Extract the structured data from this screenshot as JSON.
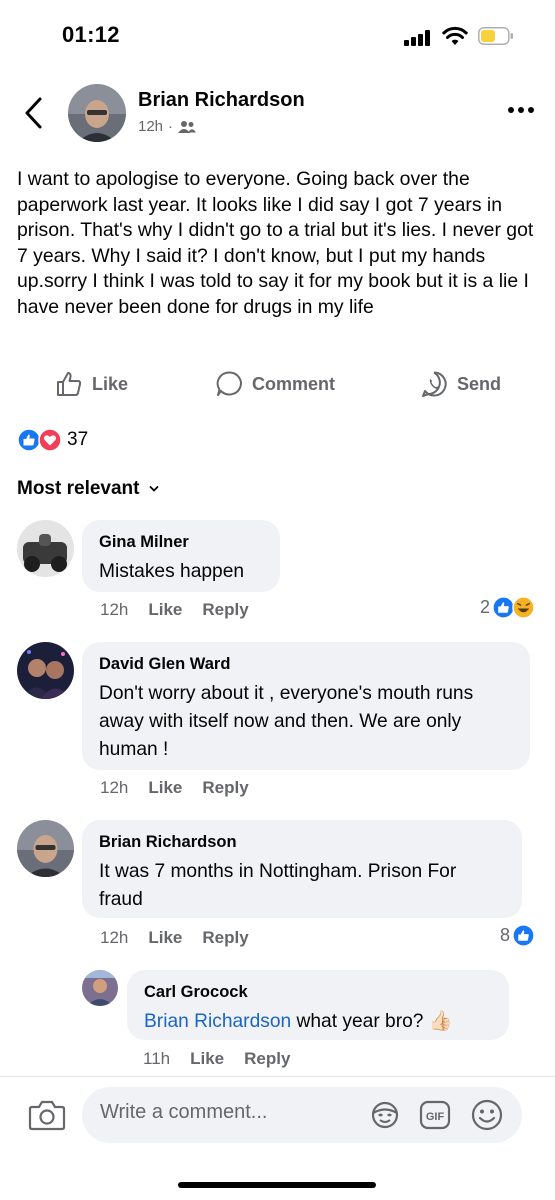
{
  "status": {
    "time": "01:12"
  },
  "post": {
    "author": "Brian Richardson",
    "time": "12h",
    "text": "I want to apologise to everyone. Going back over the paperwork last year. It looks like I did say I got 7 years in prison. That's why I didn't go to a trial but it's lies. I never got 7 years. Why I said it? I don't know, but I put my hands up.sorry I think I was told to say it for my book but it is a lie  I have never been done for drugs  in my life"
  },
  "actions": {
    "like": "Like",
    "comment": "Comment",
    "send": "Send"
  },
  "reactions": {
    "count": "37",
    "icons": [
      "like-icon",
      "love-icon"
    ]
  },
  "sort_label": "Most relevant",
  "comments": [
    {
      "name": "Gina Milner",
      "text": "Mistakes happen",
      "time": "12h",
      "like": "Like",
      "reply": "Reply",
      "reaction_count": "2"
    },
    {
      "name": "David Glen Ward",
      "text": "Don't worry about it , everyone's mouth runs away with itself now and then. We are only human !",
      "time": "12h",
      "like": "Like",
      "reply": "Reply"
    },
    {
      "name": "Brian Richardson",
      "text": "It was 7 months in Nottingham. Prison For fraud",
      "time": "12h",
      "like": "Like",
      "reply": "Reply",
      "reaction_count": "8"
    },
    {
      "name": "Carl Grocock",
      "mention": "Brian Richardson",
      "text": " what year bro? 👍🏻",
      "time": "11h",
      "like": "Like",
      "reply": "Reply"
    }
  ],
  "composer": {
    "placeholder": "Write a comment..."
  },
  "colors": {
    "facebook_blue": "#1877f2",
    "love_red": "#f33e58",
    "mention": "#1a65c8",
    "bubble": "#f0f2f5",
    "battery": "#f7d23e"
  }
}
